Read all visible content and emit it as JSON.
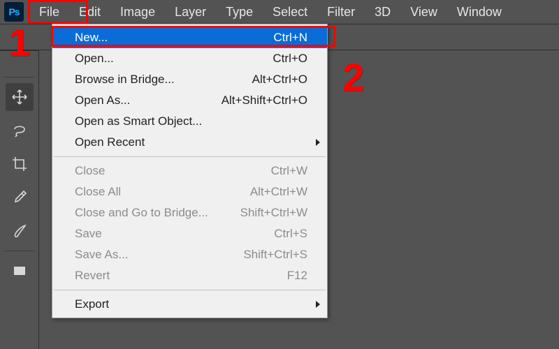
{
  "app": {
    "icon_text": "Ps"
  },
  "menubar": {
    "items": [
      "File",
      "Edit",
      "Image",
      "Layer",
      "Type",
      "Select",
      "Filter",
      "3D",
      "View",
      "Window"
    ]
  },
  "file_menu": {
    "new": {
      "label": "New...",
      "shortcut": "Ctrl+N"
    },
    "open": {
      "label": "Open...",
      "shortcut": "Ctrl+O"
    },
    "browse": {
      "label": "Browse in Bridge...",
      "shortcut": "Alt+Ctrl+O"
    },
    "open_as": {
      "label": "Open As...",
      "shortcut": "Alt+Shift+Ctrl+O"
    },
    "open_smart": {
      "label": "Open as Smart Object...",
      "shortcut": ""
    },
    "open_recent": {
      "label": "Open Recent",
      "shortcut": ""
    },
    "close": {
      "label": "Close",
      "shortcut": "Ctrl+W"
    },
    "close_all": {
      "label": "Close All",
      "shortcut": "Alt+Ctrl+W"
    },
    "close_bridge": {
      "label": "Close and Go to Bridge...",
      "shortcut": "Shift+Ctrl+W"
    },
    "save": {
      "label": "Save",
      "shortcut": "Ctrl+S"
    },
    "save_as": {
      "label": "Save As...",
      "shortcut": "Shift+Ctrl+S"
    },
    "revert": {
      "label": "Revert",
      "shortcut": "F12"
    },
    "export": {
      "label": "Export",
      "shortcut": ""
    }
  },
  "tools": {
    "move": "Move Tool",
    "lasso": "Lasso Tool",
    "crop": "Crop Tool",
    "eyedrop": "Eyedropper Tool",
    "brush": "Brush Tool",
    "rect": "Rectangle Tool"
  },
  "annotations": {
    "one": "1",
    "two": "2"
  }
}
